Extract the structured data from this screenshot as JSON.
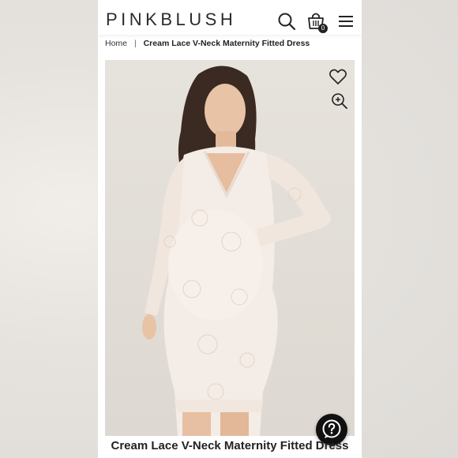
{
  "header": {
    "logo": "PINKBLUSH",
    "icons": [
      "search-icon",
      "shopping-bag-icon",
      "menu-icon"
    ],
    "cart_count": "0"
  },
  "breadcrumb": {
    "home": "Home",
    "separator": "|",
    "current": "Cream Lace V-Neck Maternity Fitted Dress"
  },
  "product": {
    "image_actions": [
      "heart-icon",
      "zoom-in-icon"
    ],
    "title": "Cream Lace V-Neck Maternity Fitted Dress"
  },
  "help": {
    "icon": "question-icon"
  }
}
